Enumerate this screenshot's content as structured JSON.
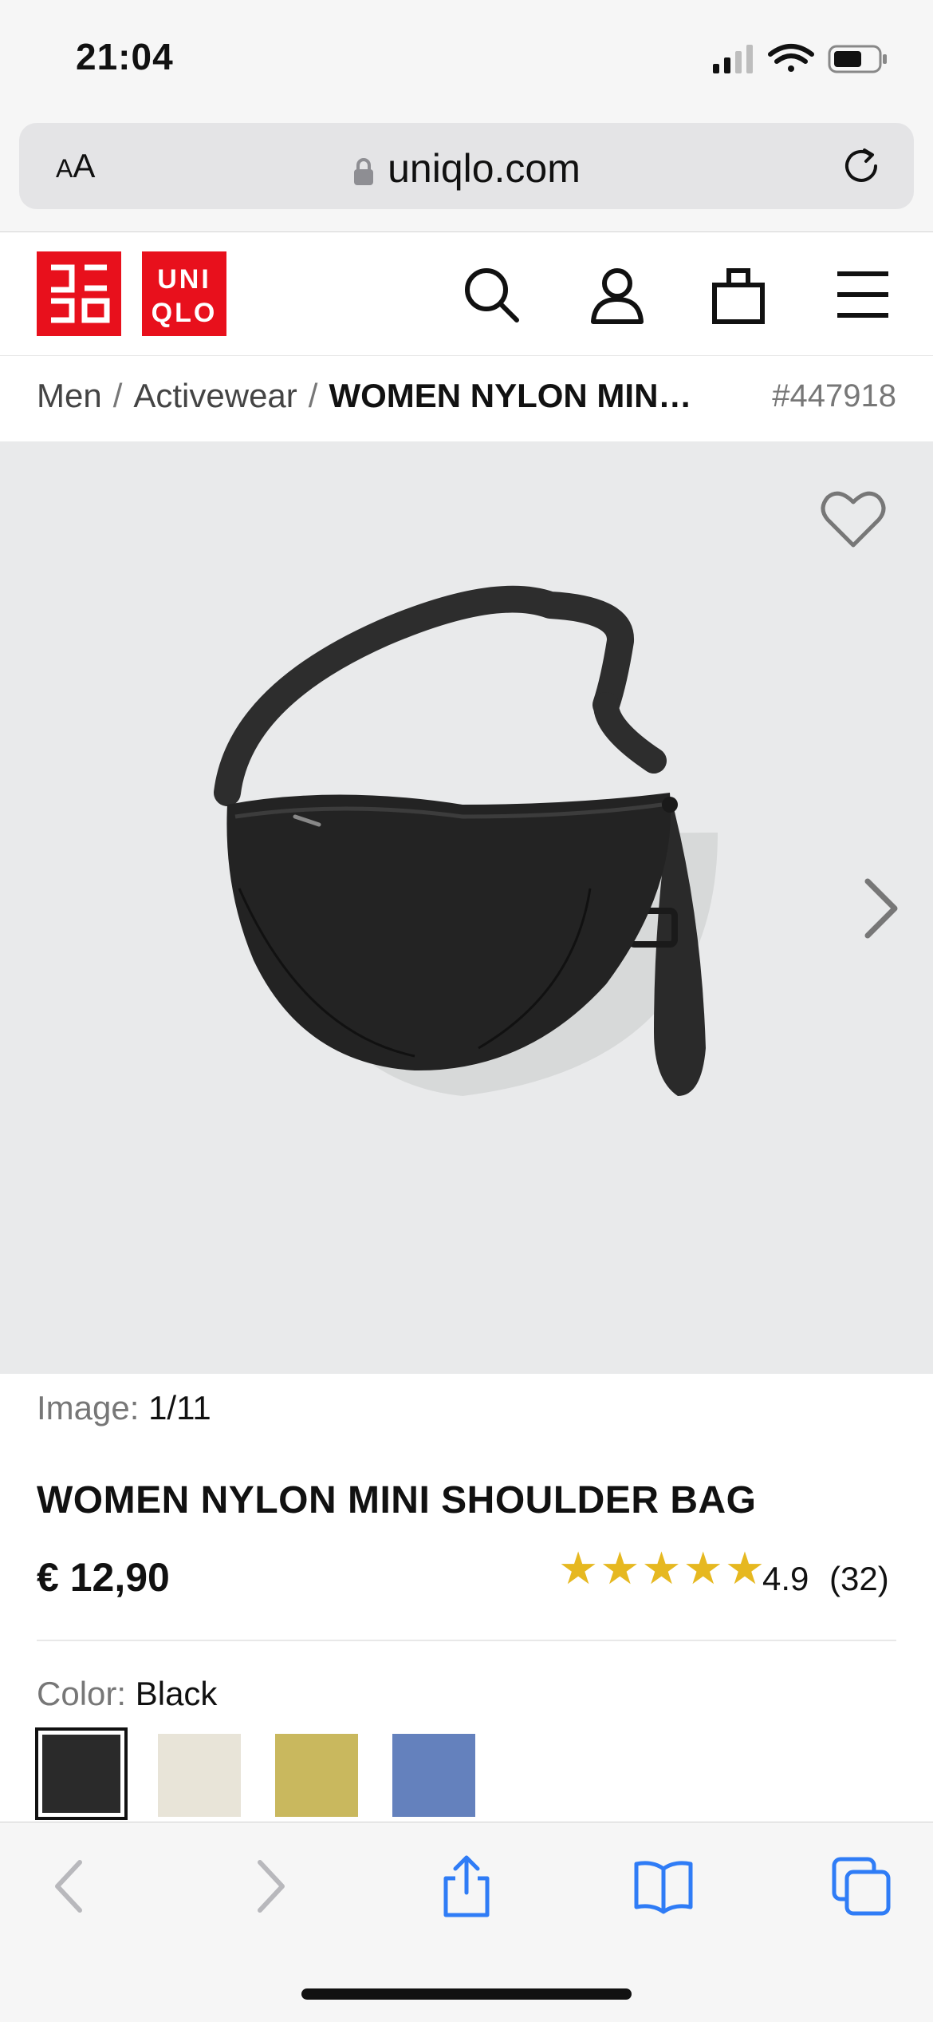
{
  "status_bar": {
    "time": "21:04"
  },
  "browser": {
    "text_size_label": "AA",
    "url": "uniqlo.com"
  },
  "site": {
    "logo_top": [
      "ユニ",
      "クロ"
    ],
    "logo_bottom": [
      "UNI",
      "QLO"
    ],
    "brand_color": "#e8101c"
  },
  "breadcrumb": {
    "items": [
      "Men",
      "Activewear"
    ],
    "current": "WOMEN NYLON MIN…",
    "product_code": "#447918"
  },
  "product": {
    "image_label": "Image:",
    "image_index": "1/11",
    "title": "WOMEN NYLON MINI SHOULDER BAG",
    "price": "€ 12,90",
    "stars": "★★★★★",
    "rating": "4.9",
    "review_count": "(32)",
    "color_label": "Color:",
    "color_value": "Black",
    "swatches": [
      {
        "name": "Black",
        "color": "#2a2a2a",
        "selected": true
      },
      {
        "name": "Off White",
        "color": "#e8e4d8",
        "selected": false
      },
      {
        "name": "Yellow",
        "color": "#c9b85e",
        "selected": false
      },
      {
        "name": "Blue",
        "color": "#6481bd",
        "selected": false
      }
    ]
  },
  "icons": {
    "header": [
      "search-icon",
      "account-icon",
      "cart-icon",
      "menu-icon"
    ],
    "toolbar": [
      "back-icon",
      "forward-icon",
      "share-icon",
      "bookmarks-icon",
      "tabs-icon"
    ]
  },
  "colors": {
    "star": "#e6b820",
    "safari_blue": "#2f7cf6"
  }
}
